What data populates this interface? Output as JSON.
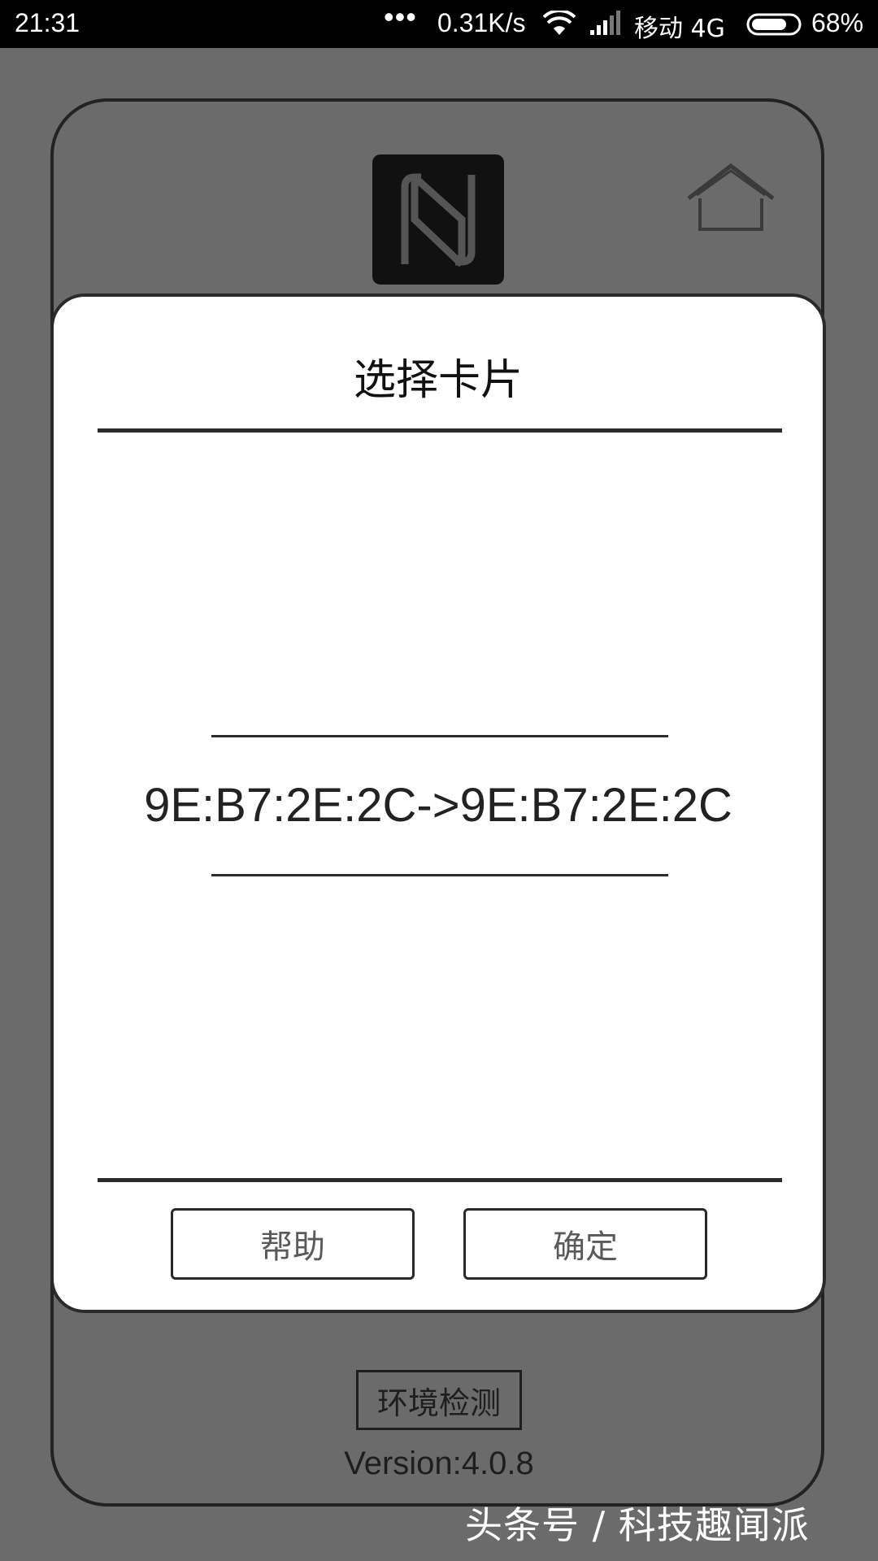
{
  "status_bar": {
    "time": "21:31",
    "dots": "•••",
    "network_speed": "0.31K/s",
    "carrier": "移动 4G",
    "battery": "68%",
    "icons": [
      "wifi-icon",
      "signal-icon",
      "battery-icon"
    ]
  },
  "app": {
    "logo": "nfc-logo",
    "home_icon": "home-icon",
    "env_check_button": "环境检测",
    "version": "Version:4.0.8"
  },
  "dialog": {
    "title": "选择卡片",
    "card_items": [
      "9E:B7:2E:2C->9E:B7:2E:2C"
    ],
    "help_button": "帮助",
    "ok_button": "确定"
  },
  "watermark": "头条号 / 科技趣闻派",
  "colors": {
    "overlay_background": "#6b6b6b",
    "dialog_background": "#ffffff",
    "status_bar": "#000000"
  }
}
